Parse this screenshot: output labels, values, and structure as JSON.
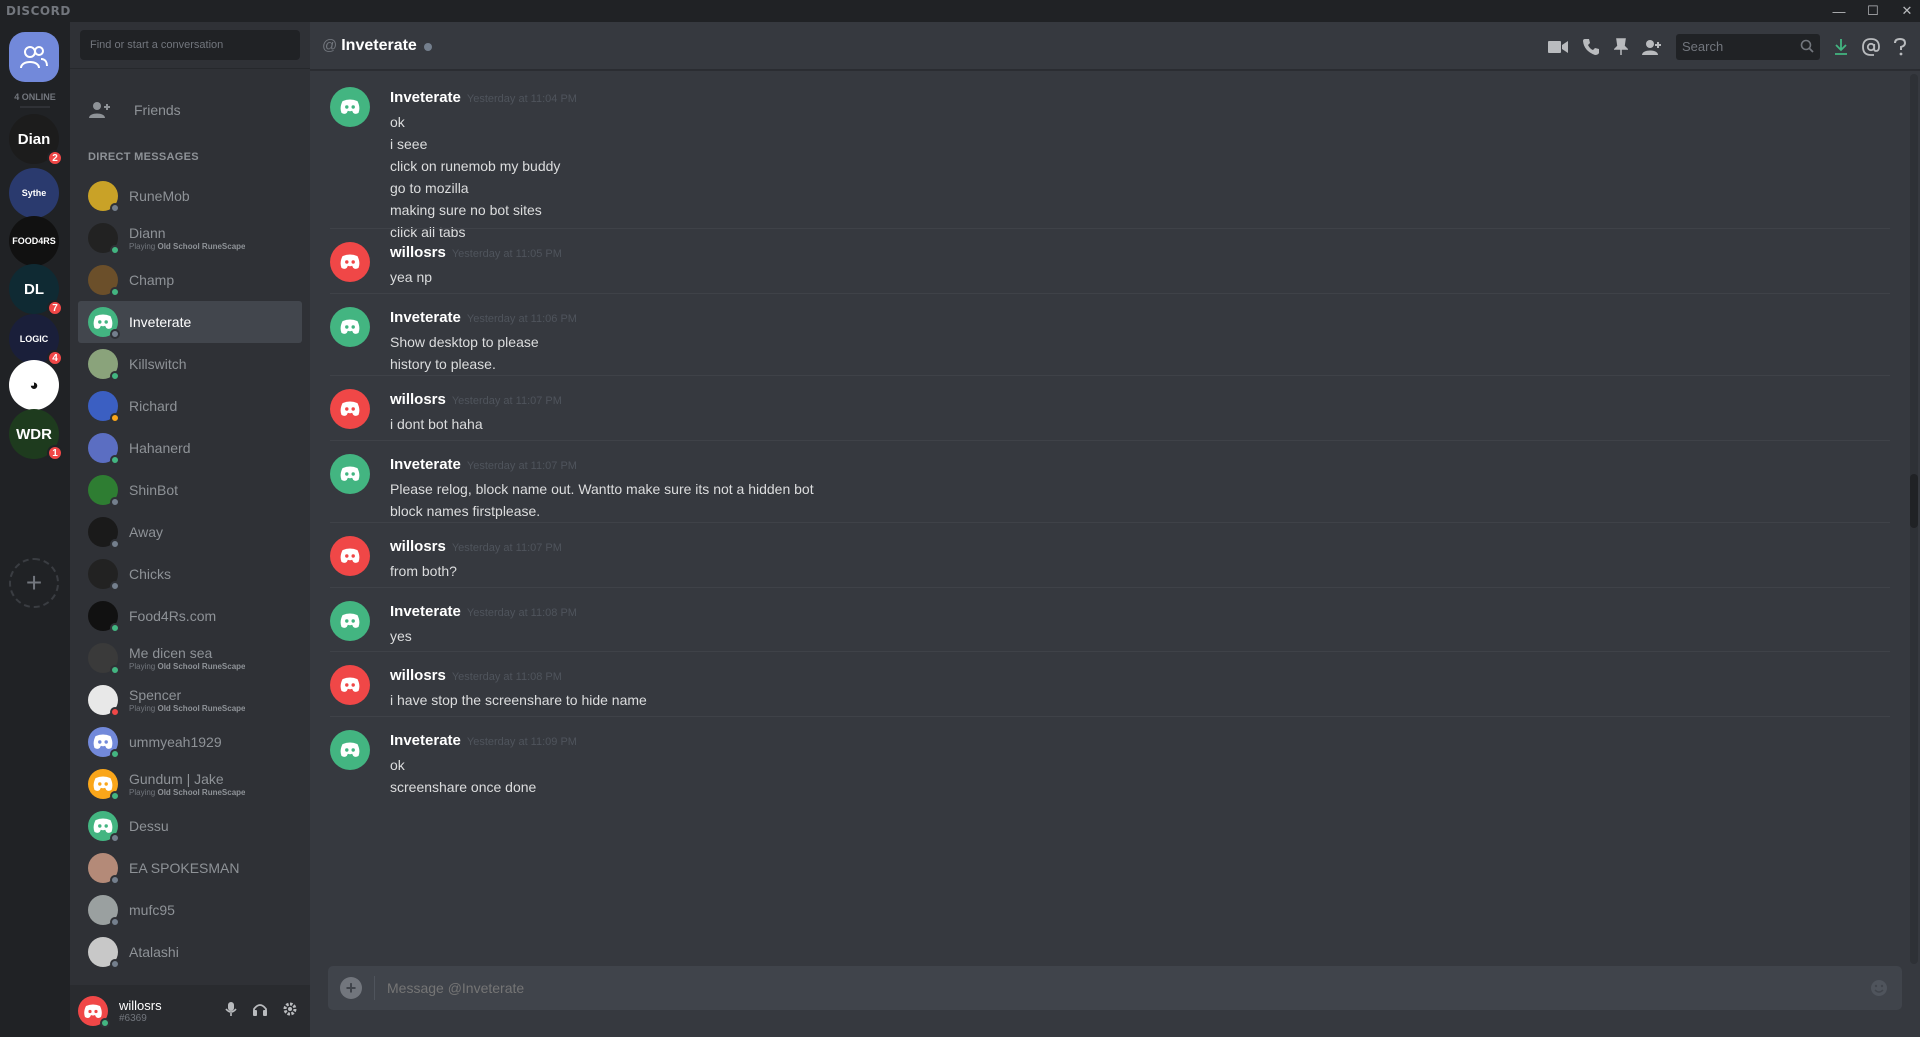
{
  "app": {
    "brand": "DISCORD"
  },
  "window_controls": {
    "minimize": "—",
    "maximize": "☐",
    "close": "✕"
  },
  "guilds": {
    "online_label": "4 ONLINE",
    "items": [
      {
        "name": "Diann",
        "initials": "Dian",
        "bg": "#1c1c1c",
        "badge": "2"
      },
      {
        "name": "Sythe",
        "initials": "Sythe",
        "bg": "#2a3a6e",
        "badge": null
      },
      {
        "name": "Food4Rs",
        "initials": "FOOD4RS",
        "bg": "#111111",
        "badge": null
      },
      {
        "name": "DL",
        "initials": "DL",
        "bg": "#0f2a33",
        "badge": "7"
      },
      {
        "name": "LOGIC",
        "initials": "LOGIC",
        "bg": "#1a1f3a",
        "badge": "4"
      },
      {
        "name": "Panda",
        "initials": "◕",
        "bg": "#ffffff",
        "badge": null
      },
      {
        "name": "WDR",
        "initials": "WDR",
        "bg": "#1e3b1e",
        "badge": "1"
      }
    ],
    "add_label": "+"
  },
  "dm_panel": {
    "search_placeholder": "Find or start a conversation",
    "friends_label": "Friends",
    "header": "DIRECT MESSAGES",
    "items": [
      {
        "name": "RuneMob",
        "sub": null,
        "status": "#747f8d",
        "bg": "#c9a227",
        "active": false
      },
      {
        "name": "Diann",
        "sub_prefix": "Playing ",
        "sub_game": "Old School RuneScape",
        "status": "#43b581",
        "bg": "#222222",
        "active": false
      },
      {
        "name": "Champ",
        "sub": null,
        "status": "#43b581",
        "bg": "#6b4f2a",
        "active": false
      },
      {
        "name": "Inveterate",
        "sub": null,
        "status": "#747f8d",
        "bg": "#43b581",
        "active": true
      },
      {
        "name": "Killswitch",
        "sub": null,
        "status": "#43b581",
        "bg": "#8aa37b",
        "active": false
      },
      {
        "name": "Richard",
        "sub": null,
        "status": "#faa61a",
        "bg": "#3b5fc2",
        "active": false
      },
      {
        "name": "Hahanerd",
        "sub": null,
        "status": "#43b581",
        "bg": "#5b6ec2",
        "active": false
      },
      {
        "name": "ShinBot",
        "sub": null,
        "status": "#747f8d",
        "bg": "#2e7d32",
        "active": false
      },
      {
        "name": "Away",
        "sub": null,
        "status": "#747f8d",
        "bg": "#1a1a1a",
        "active": false
      },
      {
        "name": "Chicks",
        "sub": null,
        "status": "#747f8d",
        "bg": "#222222",
        "active": false
      },
      {
        "name": "Food4Rs.com",
        "sub": null,
        "status": "#43b581",
        "bg": "#111111",
        "active": false
      },
      {
        "name": "Me dicen sea",
        "sub_prefix": "Playing ",
        "sub_game": "Old School RuneScape",
        "status": "#43b581",
        "bg": "#3a3a3a",
        "active": false
      },
      {
        "name": "Spencer",
        "sub_prefix": "Playing ",
        "sub_game": "Old School RuneScape",
        "status": "#f04747",
        "bg": "#e8e8e8",
        "active": false
      },
      {
        "name": "ummyeah1929",
        "sub": null,
        "status": "#43b581",
        "bg": "#7289da",
        "active": false
      },
      {
        "name": "Gundum | Jake",
        "sub_prefix": "Playing ",
        "sub_game": "Old School RuneScape",
        "status": "#43b581",
        "bg": "#faa61a",
        "active": false
      },
      {
        "name": "Dessu",
        "sub": null,
        "status": "#747f8d",
        "bg": "#43b581",
        "active": false
      },
      {
        "name": "EA SPOKESMAN",
        "sub": null,
        "status": "#747f8d",
        "bg": "#b48a78",
        "active": false
      },
      {
        "name": "mufc95",
        "sub": null,
        "status": "#747f8d",
        "bg": "#9aa0a0",
        "active": false
      },
      {
        "name": "Atalashi",
        "sub": null,
        "status": "#747f8d",
        "bg": "#c8c8c8",
        "active": false
      }
    ]
  },
  "user": {
    "name": "willosrs",
    "discriminator": "#6369",
    "status": "#43b581"
  },
  "chat": {
    "channel_at": "@",
    "channel_name": "Inveterate",
    "search_placeholder": "Search",
    "composer_placeholder": "Message @Inveterate",
    "messages": [
      {
        "author": "Inveterate",
        "color": "#43b581",
        "time": "Yesterday at 11:04 PM",
        "lines": [
          "ok",
          "i seee",
          "click on runemob my buddy",
          "go to mozilla",
          "making sure no bot sites",
          "click all tabs"
        ]
      },
      {
        "author": "willosrs",
        "color": "#f04747",
        "time": "Yesterday at 11:05 PM",
        "lines": [
          "yea np"
        ]
      },
      {
        "author": "Inveterate",
        "color": "#43b581",
        "time": "Yesterday at 11:06 PM",
        "lines": [
          "Show desktop to please",
          "history to please."
        ]
      },
      {
        "author": "willosrs",
        "color": "#f04747",
        "time": "Yesterday at 11:07 PM",
        "lines": [
          "i dont bot haha"
        ]
      },
      {
        "author": "Inveterate",
        "color": "#43b581",
        "time": "Yesterday at 11:07 PM",
        "lines": [
          "Please relog, block name out. Wantto make sure its not a hidden bot",
          "block names firstplease."
        ]
      },
      {
        "author": "willosrs",
        "color": "#f04747",
        "time": "Yesterday at 11:07 PM",
        "lines": [
          "from both?"
        ]
      },
      {
        "author": "Inveterate",
        "color": "#43b581",
        "time": "Yesterday at 11:08 PM",
        "lines": [
          "yes"
        ]
      },
      {
        "author": "willosrs",
        "color": "#f04747",
        "time": "Yesterday at 11:08 PM",
        "lines": [
          "i have stop the screenshare to hide name"
        ]
      },
      {
        "author": "Inveterate",
        "color": "#43b581",
        "time": "Yesterday at 11:09 PM",
        "lines": [
          "ok",
          "screenshare once done"
        ]
      }
    ]
  }
}
